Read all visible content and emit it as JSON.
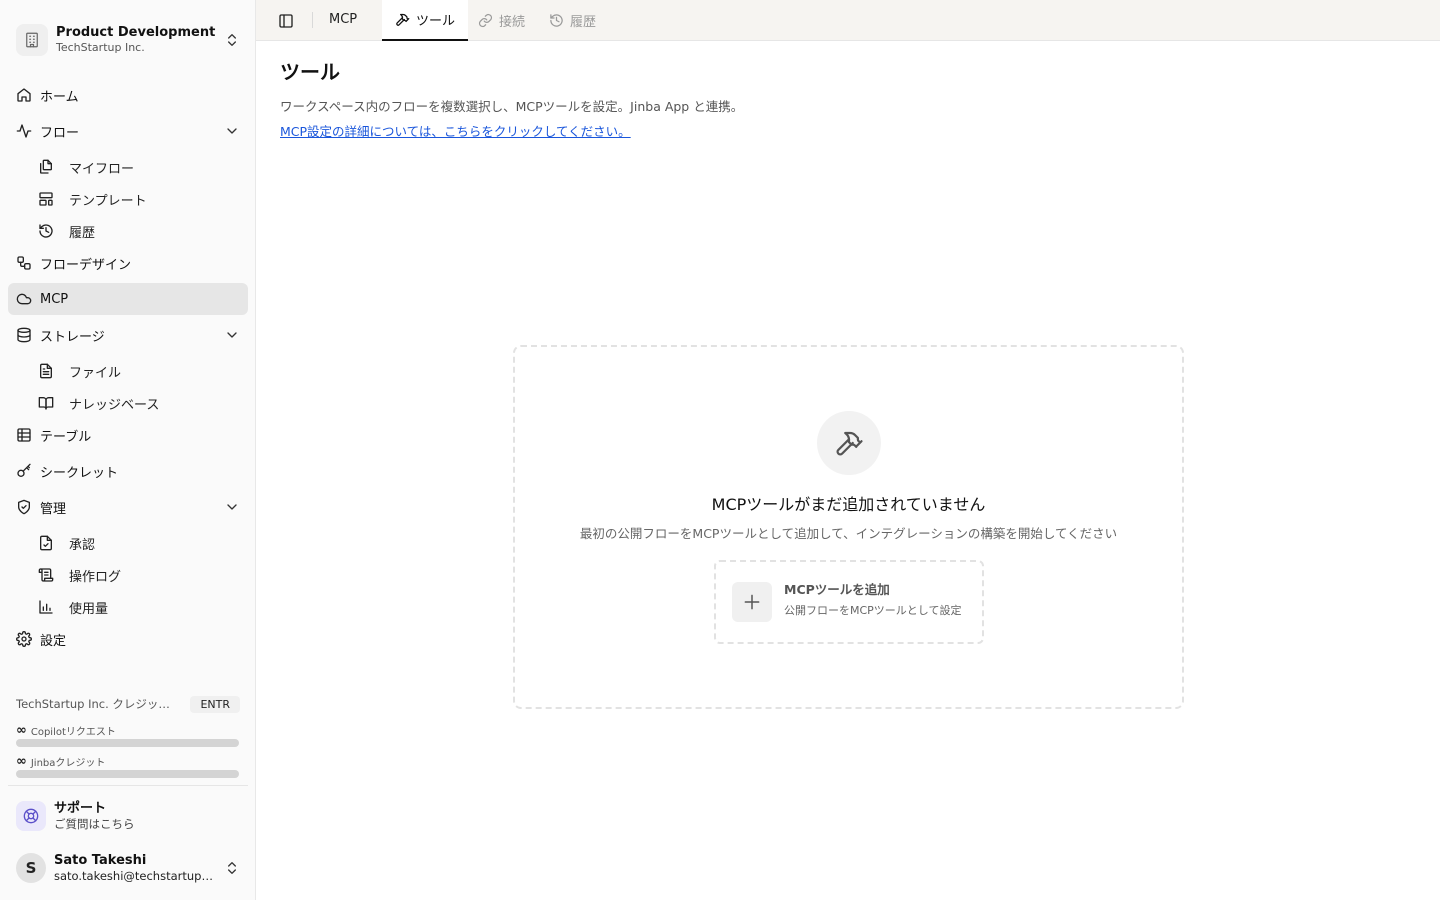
{
  "org": {
    "name": "Product Development",
    "company": "TechStartup Inc."
  },
  "nav": {
    "home": "ホーム",
    "flow": "フロー",
    "my_flow": "マイフロー",
    "templates": "テンプレート",
    "history": "履歴",
    "flow_design": "フローデザイン",
    "mcp": "MCP",
    "storage": "ストレージ",
    "files": "ファイル",
    "knowledge_base": "ナレッジベース",
    "tables": "テーブル",
    "secrets": "シークレット",
    "admin": "管理",
    "approval": "承認",
    "audit_log": "操作ログ",
    "usage": "使用量",
    "settings": "設定"
  },
  "credits": {
    "title": "TechStartup Inc. クレジット使用状況",
    "plan": "ENTR",
    "copilot_label": "Copilotリクエスト",
    "jinba_label": "Jinbaクレジット",
    "infinity": "∞",
    "copilot_fraction": 1.0,
    "jinba_fraction": 1.0
  },
  "support": {
    "title": "サポート",
    "subtitle": "ご質問はこちら"
  },
  "user": {
    "initial": "S",
    "name": "Sato Takeshi",
    "email": "sato.takeshi@techstartup.com"
  },
  "topbar": {
    "section": "MCP",
    "tabs": [
      {
        "label": "ツール",
        "active": true
      },
      {
        "label": "接続",
        "disabled": true
      },
      {
        "label": "履歴",
        "disabled": true
      }
    ]
  },
  "main": {
    "title": "ツール",
    "description": "ワークスペース内のフローを複数選択し、MCPツールを設定。Jinba App と連携。",
    "link": "MCP設定の詳細については、こちらをクリックしてください。"
  },
  "empty": {
    "title": "MCPツールがまだ追加されていません",
    "subtitle": "最初の公開フローをMCPツールとして追加して、インテグレーションの構築を開始してください",
    "add_title": "MCPツールを追加",
    "add_subtitle": "公開フローをMCPツールとして設定"
  },
  "colors": {
    "link": "#1a56db",
    "active_nav_bg": "#e6e6e6",
    "topbar_bg": "#f6f4f1",
    "support_bg": "#eae8fb"
  }
}
